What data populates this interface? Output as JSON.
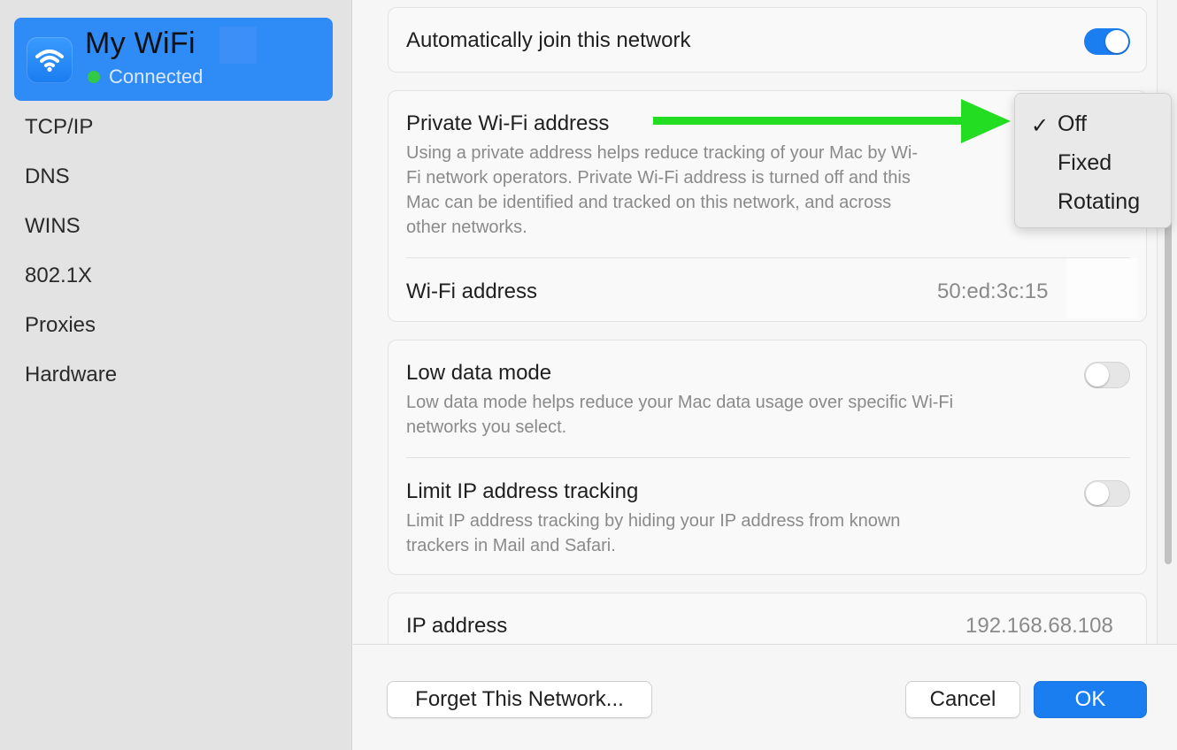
{
  "sidebar": {
    "network_name": "My WiFi",
    "network_status": "Connected",
    "items": [
      "TCP/IP",
      "DNS",
      "WINS",
      "802.1X",
      "Proxies",
      "Hardware"
    ]
  },
  "auto_join": {
    "label": "Automatically join this network",
    "enabled": true
  },
  "private_address": {
    "title": "Private Wi-Fi address",
    "desc_lines": [
      "Using a private address helps reduce tracking of your Mac by Wi-",
      "Fi network operators. Private Wi-Fi address is turned off and this",
      "Mac can be identified and tracked on this network, and across",
      "other networks."
    ],
    "wifi_address_label": "Wi-Fi address",
    "wifi_address_value": "50:ed:3c:15"
  },
  "menu": {
    "selected": "Off",
    "check_mark": "✓",
    "options": [
      "Off",
      "Fixed",
      "Rotating"
    ]
  },
  "low_data": {
    "title": "Low data mode",
    "desc_lines": [
      "Low data mode helps reduce your Mac data usage over specific Wi-Fi",
      "networks you select."
    ],
    "enabled": false
  },
  "limit_ip": {
    "title": "Limit IP address tracking",
    "desc_lines": [
      "Limit IP address tracking by hiding your IP address from known",
      "trackers in Mail and Safari."
    ],
    "enabled": false
  },
  "ip_address": {
    "label": "IP address",
    "value": "192.168.68.108"
  },
  "footer": {
    "forget_label": "Forget This Network...",
    "cancel_label": "Cancel",
    "ok_label": "OK"
  },
  "colors": {
    "accent": "#1a7df0",
    "sidebar_selected": "#2f8bf5",
    "status_green": "#31c945",
    "annotation_arrow": "#22dd22"
  }
}
